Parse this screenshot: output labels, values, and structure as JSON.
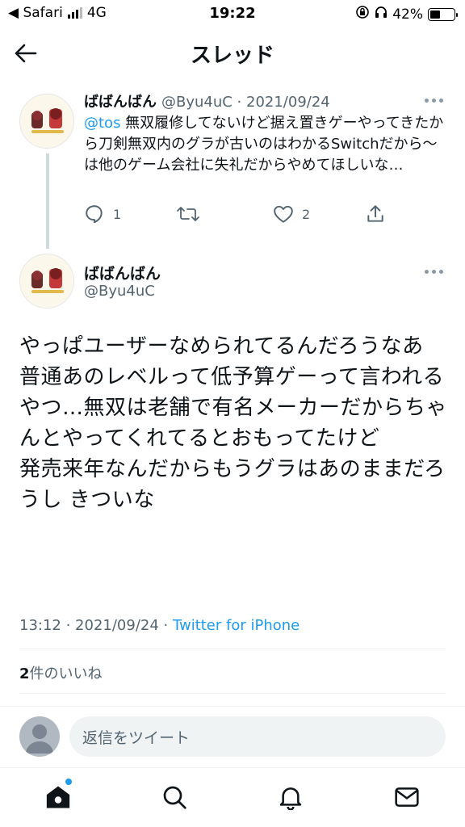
{
  "status_bar": {
    "back_app": "◀ Safari",
    "network": "4G",
    "time": "19:22",
    "battery": "42%",
    "battery_level": 0.42
  },
  "header": {
    "title": "スレッド"
  },
  "reply_tweet": {
    "display_name": "ばばんばん",
    "meta": "@Byu4uC · 2021/09/24",
    "mention": "@tos",
    "body": " 無双履修してないけど据え置きゲーやってきたから刀剣無双内のグラが古いのはわかるSwitchだから〜は他のゲーム会社に失礼だからやめてほしいな…",
    "reply_count": "1",
    "like_count": "2"
  },
  "main_tweet": {
    "display_name": "ばばんばん",
    "handle": "@Byu4uC",
    "text": "やっぱユーザーなめられてるんだろうなあ\n普通あのレベルって低予算ゲーって言われるやつ…無双は老舗で有名メーカーだからちゃんとやってくれてるとおもってたけど\n発売来年なんだからもうグラはあのままだろうし きついな",
    "timestamp": "13:12 · 2021/09/24 · ",
    "source": "Twitter for iPhone",
    "likes_count": "2",
    "likes_label": "件のいいね"
  },
  "reply_bar": {
    "placeholder": "返信をツイート"
  },
  "tabs": [
    {
      "name": "home-icon"
    },
    {
      "name": "search-icon"
    },
    {
      "name": "notifications-icon"
    },
    {
      "name": "messages-icon"
    }
  ],
  "colors": {
    "accent": "#1d9bf0",
    "secondary_text": "#536471",
    "primary_text": "#0f1419"
  }
}
